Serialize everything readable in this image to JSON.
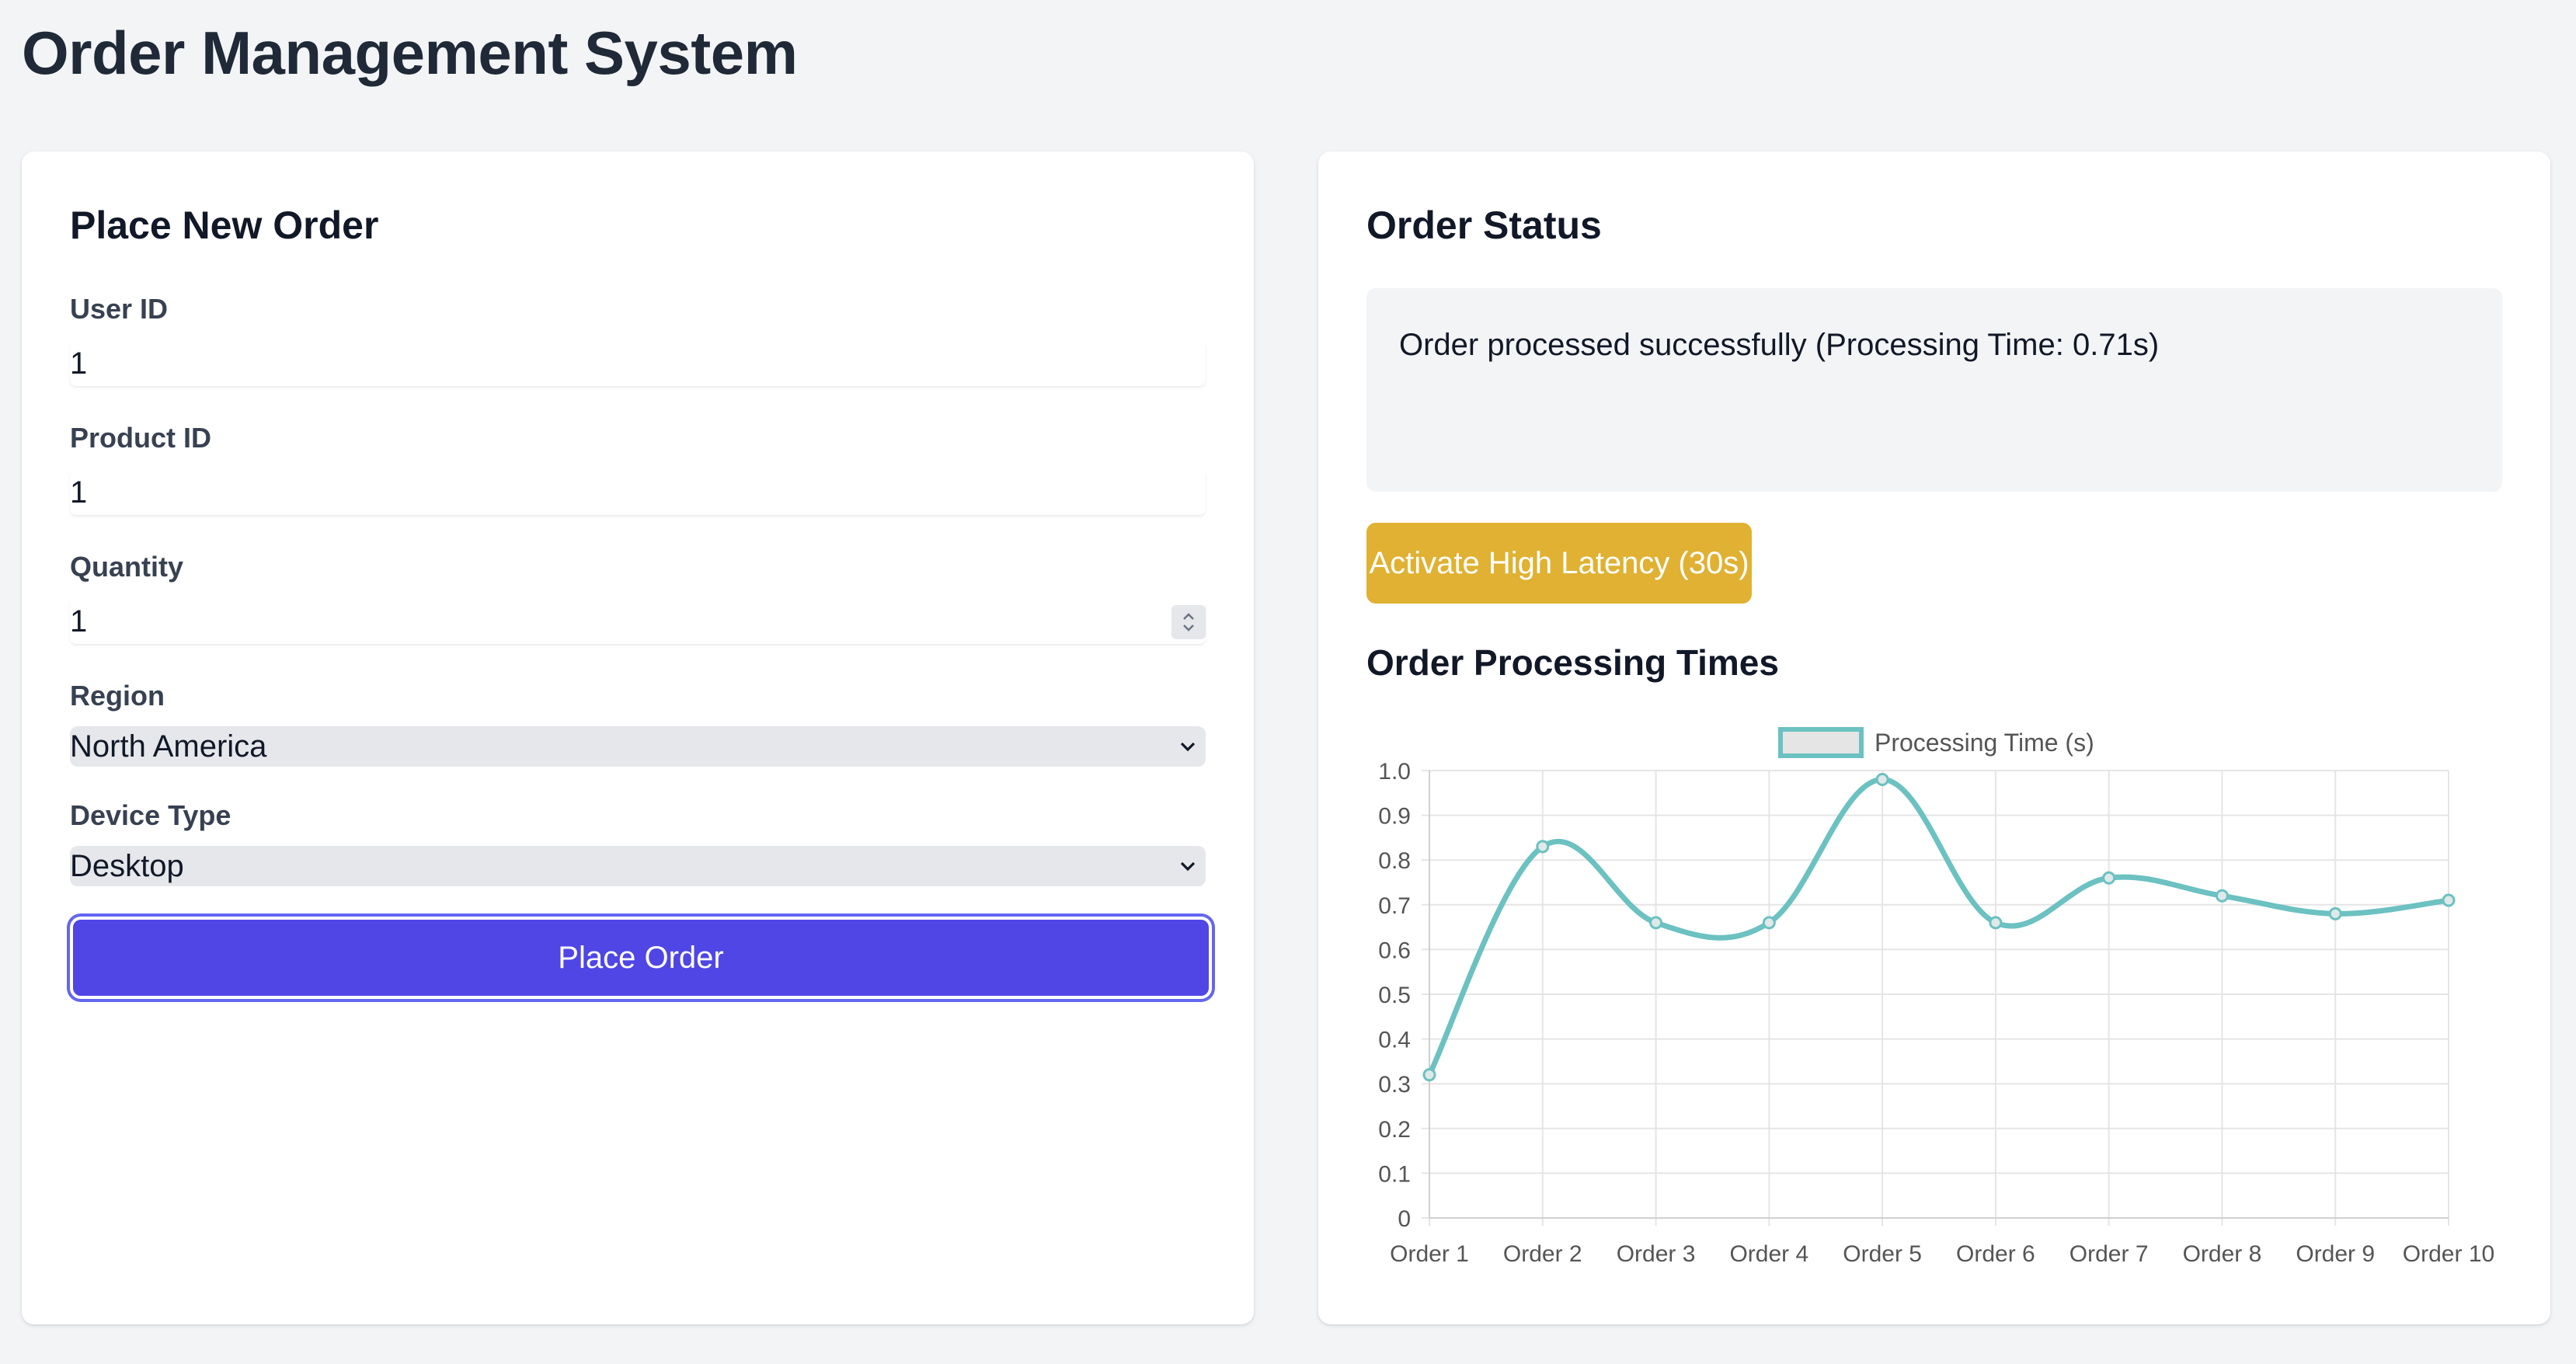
{
  "page": {
    "title": "Order Management System"
  },
  "order_form": {
    "title": "Place New Order",
    "user_id": {
      "label": "User ID",
      "value": "1"
    },
    "product_id": {
      "label": "Product ID",
      "value": "1"
    },
    "quantity": {
      "label": "Quantity",
      "value": "1"
    },
    "region": {
      "label": "Region",
      "selected": "North America"
    },
    "device_type": {
      "label": "Device Type",
      "selected": "Desktop"
    },
    "submit_label": "Place Order"
  },
  "order_status": {
    "title": "Order Status",
    "message": "Order processed successfully (Processing Time: 0.71s)",
    "latency_button_label": "Activate High Latency (30s)"
  },
  "chart_section": {
    "title": "Order Processing Times"
  },
  "colors": {
    "primary": "#4f46e5",
    "warning": "#e0b132",
    "series": "#6cc1c1"
  },
  "chart_data": {
    "type": "line",
    "categories": [
      "Order 1",
      "Order 2",
      "Order 3",
      "Order 4",
      "Order 5",
      "Order 6",
      "Order 7",
      "Order 8",
      "Order 9",
      "Order 10"
    ],
    "series": [
      {
        "name": "Processing Time (s)",
        "values": [
          0.32,
          0.83,
          0.66,
          0.66,
          0.98,
          0.66,
          0.76,
          0.72,
          0.68,
          0.71
        ]
      }
    ],
    "ylim": [
      0,
      1.0
    ],
    "yticks": [
      "0",
      "0.1",
      "0.2",
      "0.3",
      "0.4",
      "0.5",
      "0.6",
      "0.7",
      "0.8",
      "0.9",
      "1.0"
    ],
    "grid": true,
    "legend": "top"
  }
}
